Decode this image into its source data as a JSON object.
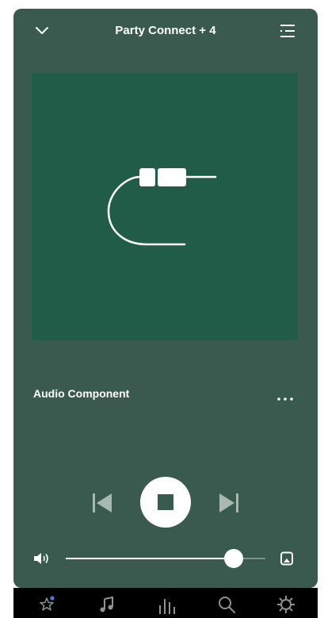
{
  "header": {
    "title": "Party Connect + 4",
    "collapse_icon": "chevron-down-icon",
    "queue_icon": "queue-list-icon"
  },
  "now_playing": {
    "artwork_icon": "audio-cable-icon",
    "track_title": "Audio Component",
    "more_icon": "more-horizontal-icon"
  },
  "controls": {
    "previous_icon": "skip-previous-icon",
    "stop_icon": "stop-icon",
    "next_icon": "skip-next-icon"
  },
  "volume": {
    "icon": "volume-icon",
    "level": 0.84,
    "output_icon": "speaker-output-icon"
  },
  "tabs": [
    {
      "name": "favorites",
      "icon": "star-icon"
    },
    {
      "name": "music",
      "icon": "music-note-icon"
    },
    {
      "name": "equalizer",
      "icon": "equalizer-icon"
    },
    {
      "name": "search",
      "icon": "search-icon"
    },
    {
      "name": "settings",
      "icon": "gear-icon"
    }
  ],
  "colors": {
    "card": "#3b5a4f",
    "artwork": "#215c49",
    "accent_dot": "#4a7bd8",
    "tab_bar": "#000000"
  }
}
